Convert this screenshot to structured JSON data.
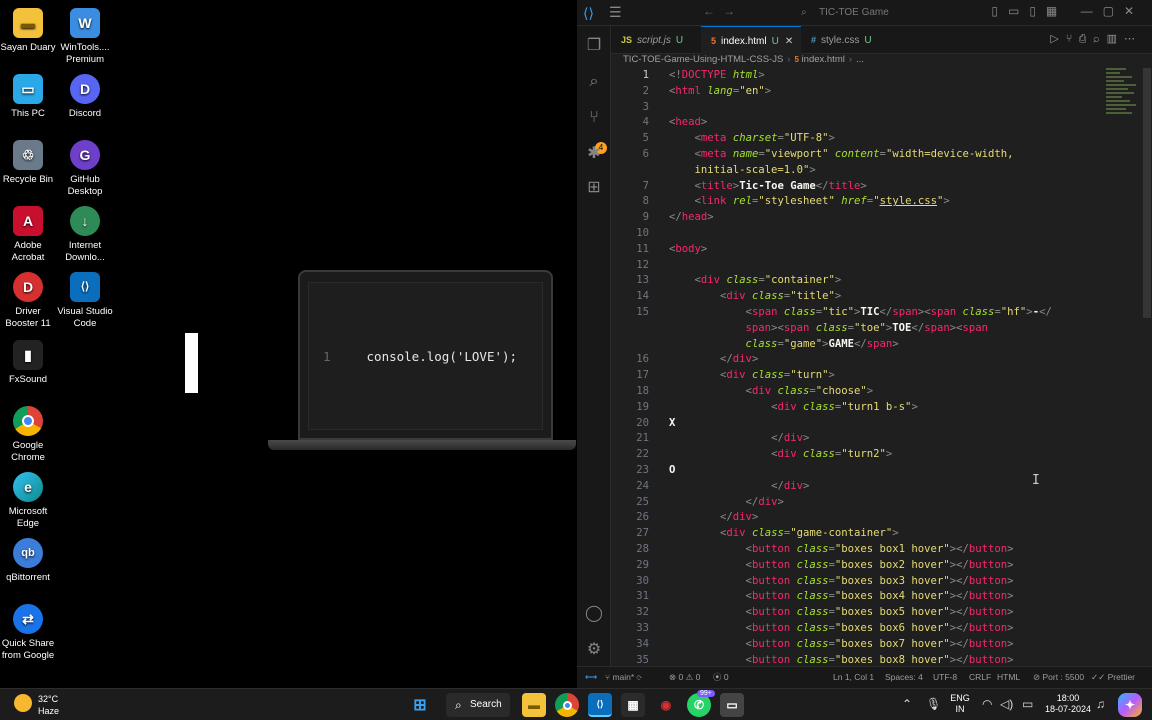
{
  "desktop": {
    "icons": [
      {
        "label": "Sayan Duary",
        "glyph": "▬",
        "color": "#f3c13a"
      },
      {
        "label": "WinTools.... Premium",
        "glyph": "W",
        "color": "#3a8de0"
      },
      {
        "label": "This PC",
        "glyph": "▭",
        "color": "#2aa8e8"
      },
      {
        "label": "Discord",
        "glyph": "D",
        "color": "#5865f2"
      },
      {
        "label": "Recycle Bin",
        "glyph": "♲",
        "color": "#6b7a8a"
      },
      {
        "label": "GitHub Desktop",
        "glyph": "G",
        "color": "#6e40c9"
      },
      {
        "label": "Adobe Acrobat",
        "glyph": "A",
        "color": "#c8102e"
      },
      {
        "label": "Internet Downlo...",
        "glyph": "↓",
        "color": "#2e8b57"
      },
      {
        "label": "Driver Booster 11",
        "glyph": "D",
        "color": "#d63031"
      },
      {
        "label": "Visual Studio Code",
        "glyph": "⟨⟩",
        "color": "#0a6ebd"
      },
      {
        "label": "FxSound",
        "glyph": "▮",
        "color": "#222222"
      },
      {
        "label": "Google Chrome",
        "glyph": "●",
        "color": "#db4437"
      },
      {
        "label": "Microsoft Edge",
        "glyph": "e",
        "color": "#0c8a8a"
      },
      {
        "label": "qBittorrent",
        "glyph": "qb",
        "color": "#3b7dd8"
      },
      {
        "label": "Quick Share from Google",
        "glyph": "⇄",
        "color": "#1a73e8"
      }
    ]
  },
  "laptop": {
    "line_number": "1",
    "code": "console.log('LOVE');"
  },
  "vscode": {
    "search_placeholder": "TIC-TOE Game",
    "tabs": [
      {
        "icon": "JS",
        "name": "script.js",
        "status": "U",
        "icon_color": "#cbcb41"
      },
      {
        "icon": "5",
        "name": "index.html",
        "status": "U",
        "icon_color": "#e37933",
        "close": "✕"
      },
      {
        "icon": "#",
        "name": "style.css",
        "status": "U",
        "icon_color": "#519aba"
      }
    ],
    "breadcrumb": {
      "folder": "TIC-TOE-Game-Using-HTML-CSS-JS",
      "file": "index.html",
      "more": "..."
    },
    "status": {
      "branch": "main*",
      "errors": "0",
      "warnings": "0",
      "ports_w": "0",
      "position": "Ln 1, Col 1",
      "spaces": "Spaces: 4",
      "encoding": "UTF-8",
      "eol": "CRLF",
      "language": "HTML",
      "port": "Port : 5500",
      "prettier": "Prettier"
    }
  },
  "taskbar": {
    "temp": "32°C",
    "weather": "Haze",
    "search_label": "Search",
    "lang1": "ENG",
    "lang2": "IN",
    "time": "18:00",
    "date": "18-07-2024",
    "badge": "99+"
  }
}
